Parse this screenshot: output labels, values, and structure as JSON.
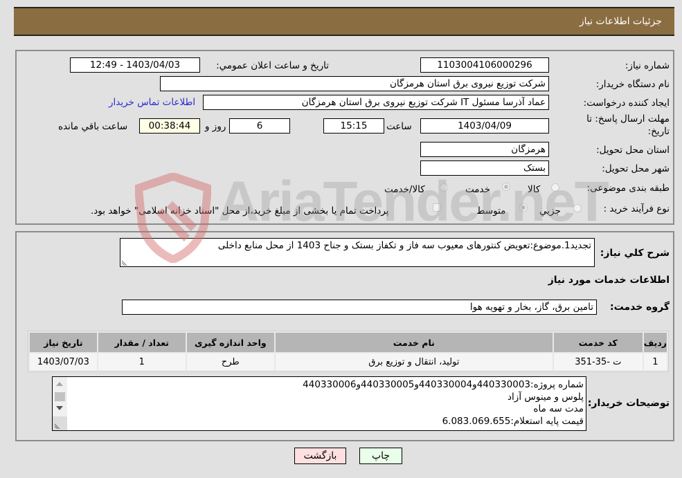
{
  "header": {
    "title": "جزئیات اطلاعات نیاز"
  },
  "form": {
    "need_number": {
      "label": "شماره نیاز:",
      "value": "1103004106000296"
    },
    "announce_datetime": {
      "label": "تاریخ و ساعت اعلان عمومي:",
      "value": "1403/04/03 - 12:49"
    },
    "buyer_org": {
      "label": "نام دستگاه خریدار:",
      "value": "شرکت توزیع نیروی برق استان هرمزگان"
    },
    "requester": {
      "label": "ایجاد کننده درخواست:",
      "value": "عماد آذرسا مسئول IT شرکت توزیع نیروی برق استان هرمزگان"
    },
    "buyer_contact_link": "اطلاعات تماس خریدار",
    "deadline": {
      "label_line1": "مهلت ارسال پاسخ: تا",
      "label_line2": "تاریخ:",
      "date": "1403/04/09",
      "time_label": "ساعت",
      "time": "15:15",
      "days": "6",
      "days_label": "روز و",
      "remaining": "00:38:44",
      "remaining_label": "ساعت باقي مانده"
    },
    "delivery_province": {
      "label": "استان محل تحویل:",
      "value": "هرمزگان"
    },
    "delivery_city": {
      "label": "شهر محل تحویل:",
      "value": "بستک"
    },
    "category": {
      "label": "طبقه بندی موضوعی:",
      "options": [
        "کالا",
        "خدمت",
        "کالا/خدمت"
      ],
      "selected": "خدمت"
    },
    "purchase_process": {
      "label": "نوع فرآیند خرید :",
      "options": [
        "جزيي",
        "متوسط"
      ],
      "selected": "متوسط",
      "treasury_checkbox_label": "پرداخت تمام یا بخشی از مبلغ خرید،از محل \"اسناد خزانه اسلامی\" خواهد بود.",
      "treasury_checked": false
    }
  },
  "description": {
    "label": "شرح کلي نیاز:",
    "value": "تجدید1.موضوع:تعویض کنتورهای معیوب سه فاز و تکفاز بستک و جناح 1403 از محل منابع داخلی"
  },
  "services_section": {
    "title": "اطلاعات خدمات مورد نیاز",
    "group_label": "گروه خدمت:",
    "group_value": "تامین برق، گاز، بخار و تهویه هوا",
    "table": {
      "headers": [
        "ردیف",
        "کد خدمت",
        "نام خدمت",
        "واحد اندازه گیری",
        "تعداد / مقدار",
        "تاریخ نیاز"
      ],
      "rows": [
        [
          "1",
          "ت -35-351",
          "تولید، انتقال و توزیع برق",
          "طرح",
          "1",
          "1403/07/03"
        ]
      ]
    }
  },
  "buyer_notes": {
    "label": "توضیحات خریدار:",
    "lines": [
      "شماره پروژه:440330003و440330004و440330005و440330006",
      " پلوس و مینوس آزاد",
      "مدت سه ماه",
      "قیمت پایه استعلام:6.083.069.655"
    ]
  },
  "buttons": {
    "print": "چاپ",
    "back": "بازگشت"
  },
  "watermark": {
    "text": "AriaTender.neT"
  },
  "colors": {
    "header_bg": "#8b6d42",
    "print_bg": "#eaffea",
    "back_bg": "#ffe0e0",
    "remaining_bg": "#ffffe6",
    "link": "#2a2ad0"
  }
}
